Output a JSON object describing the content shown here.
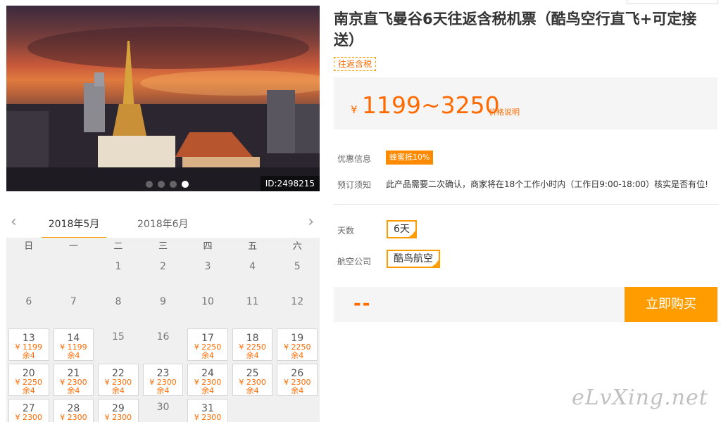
{
  "photo": {
    "id_label": "ID:2498215",
    "dots": [
      {
        "active": false
      },
      {
        "active": false
      },
      {
        "active": false
      },
      {
        "active": true
      }
    ]
  },
  "product": {
    "title": "南京直飞曼谷6天往返含税机票（酷鸟空行直飞+可定接送）",
    "tag": "往返含税",
    "price_currency": "¥",
    "price_range": "1199~3250",
    "price_note": "价格说明"
  },
  "info": {
    "promo_label": "优惠信息",
    "promo_badge": "蜂蜜抵10%",
    "notice_label": "预订须知",
    "notice_text": "此产品需要二次确认，商家将在18个工作小时内（工作日9:00-18:00）核实是否有位!"
  },
  "options": {
    "days_label": "天数",
    "days_value": "6天",
    "airline_label": "航空公司",
    "airline_value": "酷鸟航空"
  },
  "buy": {
    "total": "--",
    "button": "立即购买"
  },
  "calendar": {
    "prev_icon": "‹",
    "next_icon": "›",
    "months": [
      "2018年5月",
      "2018年6月"
    ],
    "weekdays": [
      "日",
      "一",
      "二",
      "三",
      "四",
      "五",
      "六"
    ],
    "leading_blanks": 2,
    "days": [
      {
        "d": "1"
      },
      {
        "d": "2"
      },
      {
        "d": "3"
      },
      {
        "d": "4"
      },
      {
        "d": "5"
      },
      {
        "d": "6"
      },
      {
        "d": "7"
      },
      {
        "d": "8"
      },
      {
        "d": "9"
      },
      {
        "d": "10"
      },
      {
        "d": "11"
      },
      {
        "d": "12"
      },
      {
        "d": "13",
        "price": "¥ 1199",
        "left": "余4"
      },
      {
        "d": "14",
        "price": "¥ 1199",
        "left": "余4"
      },
      {
        "d": "15"
      },
      {
        "d": "16"
      },
      {
        "d": "17",
        "price": "¥ 2250",
        "left": "余4"
      },
      {
        "d": "18",
        "price": "¥ 2250",
        "left": "余4"
      },
      {
        "d": "19",
        "price": "¥ 2250",
        "left": "余4"
      },
      {
        "d": "20",
        "price": "¥ 2250",
        "left": "余4"
      },
      {
        "d": "21",
        "price": "¥ 2300",
        "left": "余4"
      },
      {
        "d": "22",
        "price": "¥ 2300",
        "left": "余4"
      },
      {
        "d": "23",
        "price": "¥ 2300",
        "left": "余4"
      },
      {
        "d": "24",
        "price": "¥ 2300",
        "left": "余4"
      },
      {
        "d": "25",
        "price": "¥ 2300",
        "left": "余4"
      },
      {
        "d": "26",
        "price": "¥ 2300",
        "left": "余4"
      },
      {
        "d": "27",
        "price": "¥ 2300"
      },
      {
        "d": "28",
        "price": "¥ 2300"
      },
      {
        "d": "29",
        "price": "¥ 2300"
      },
      {
        "d": "30"
      },
      {
        "d": "31",
        "price": "¥ 2300"
      }
    ]
  },
  "watermark": "eLvXing.net",
  "colors": {
    "accent": "#ff9d00",
    "price": "#ff6a00"
  }
}
